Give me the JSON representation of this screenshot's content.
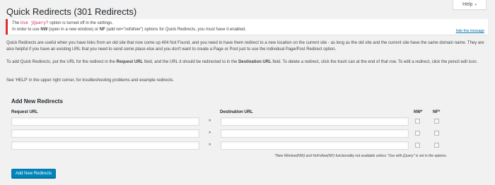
{
  "help": {
    "label": "Help",
    "arrow": "▾"
  },
  "page_title": "Quick Redirects (301 Redirects)",
  "notice": {
    "line1_pre": "The ",
    "line1_code": "Use jQuery?",
    "line1_post": " option is turned off in the settings.",
    "line2_a": "In order to use ",
    "line2_nw": "NW",
    "line2_b": " (open in a new window) or ",
    "line2_nf": "NF",
    "line2_c": " (add rel=\"nofollow\") options for Quick Redirects, you must have it enabled.",
    "hide": "hide this message"
  },
  "intro": {
    "p1": "Quick Redirects are useful when you have links from an old site that now come up 404 Not Found, and you need to have them redirect to a new location on the current site - as long as the old site and the current site have the same domain name. They are also helpful if you have an existing URL that you need to send some place else and you don't want to create a Page or Post just to use the individual Page/Post Redirect option.",
    "p2_a": "To add Quick Redirects, put the URL for the redirect in the ",
    "p2_request": "Request URL",
    "p2_b": " field, and the URL it should be redirected to in the ",
    "p2_dest": "Destination URL",
    "p2_c": " field. To delete a redirect, click the trash can at the end of that row. To edit a redirect, click the pencil edit icon.",
    "p3": "See 'HELP' in the upper right corner, for troubleshooting problems and example redirects."
  },
  "form": {
    "heading": "Add New Redirects",
    "col_request": "Request URL",
    "col_destination": "Destination URL",
    "col_nw": "NW*",
    "col_nf": "NF*",
    "arrow": "»",
    "note": "*New Window(NW) and NoFollow(NF) functionality not available unless \"Use with jQuery\" is set in the options.",
    "submit": "Add New Redirects"
  }
}
